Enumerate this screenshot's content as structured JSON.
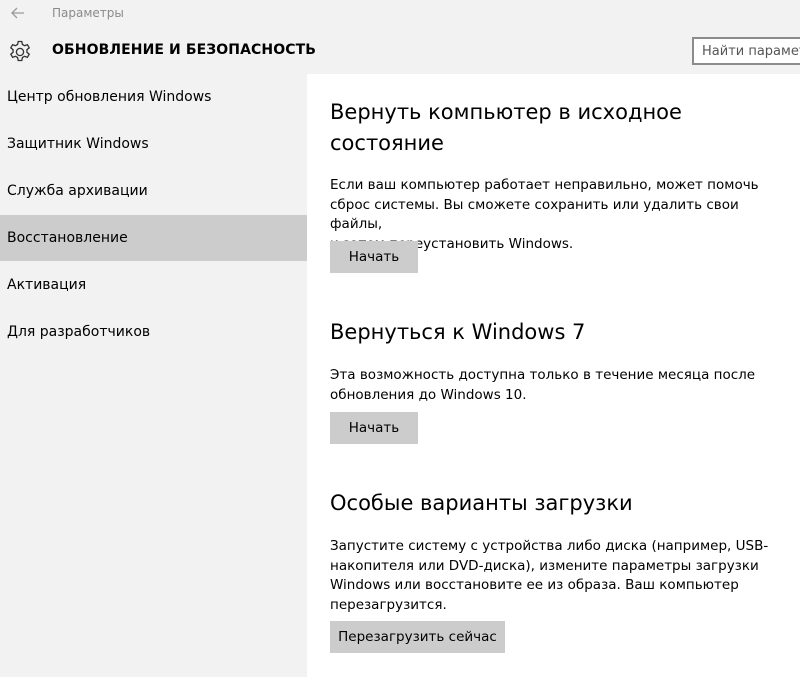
{
  "window": {
    "app_title": "Параметры"
  },
  "header": {
    "section_title": "ОБНОВЛЕНИЕ И БЕЗОПАСНОСТЬ",
    "search_placeholder": "Найти параметр"
  },
  "sidebar": {
    "selected_index": 3,
    "items": [
      {
        "label": "Центр обновления Windows"
      },
      {
        "label": "Защитник Windows"
      },
      {
        "label": "Служба архивации"
      },
      {
        "label": "Восстановление"
      },
      {
        "label": "Активация"
      },
      {
        "label": "Для разработчиков"
      }
    ]
  },
  "sections": [
    {
      "heading_line1": "Вернуть компьютер в исходное",
      "heading_line2": "состояние",
      "desc_line1": "Если ваш компьютер работает неправильно, может помочь",
      "desc_line2": "сброс системы. Вы сможете сохранить или удалить свои файлы,",
      "desc_line3": "и затем переустановить Windows.",
      "button": "Начать"
    },
    {
      "heading_line1": "Вернуться к Windows 7",
      "desc_line1": "Эта возможность доступна только в течение месяца после",
      "desc_line2": "обновления до Windows 10.",
      "button": "Начать"
    },
    {
      "heading_line1": "Особые варианты загрузки",
      "desc_line1": "Запустите систему с устройства либо диска (например, USB-",
      "desc_line2": "накопителя или DVD-диска), измените параметры загрузки",
      "desc_line3": "Windows или восстановите ее из образа. Ваш компьютер",
      "desc_line4": "перезагрузится.",
      "button": "Перезагрузить сейчас"
    }
  ],
  "icons": {
    "back": "back-arrow-icon",
    "header": "gear-icon"
  },
  "colors": {
    "chrome_bg": "#f2f2f2",
    "selected_bg": "#cccccc",
    "button_bg": "#cccccc",
    "content_bg": "#ffffff"
  }
}
